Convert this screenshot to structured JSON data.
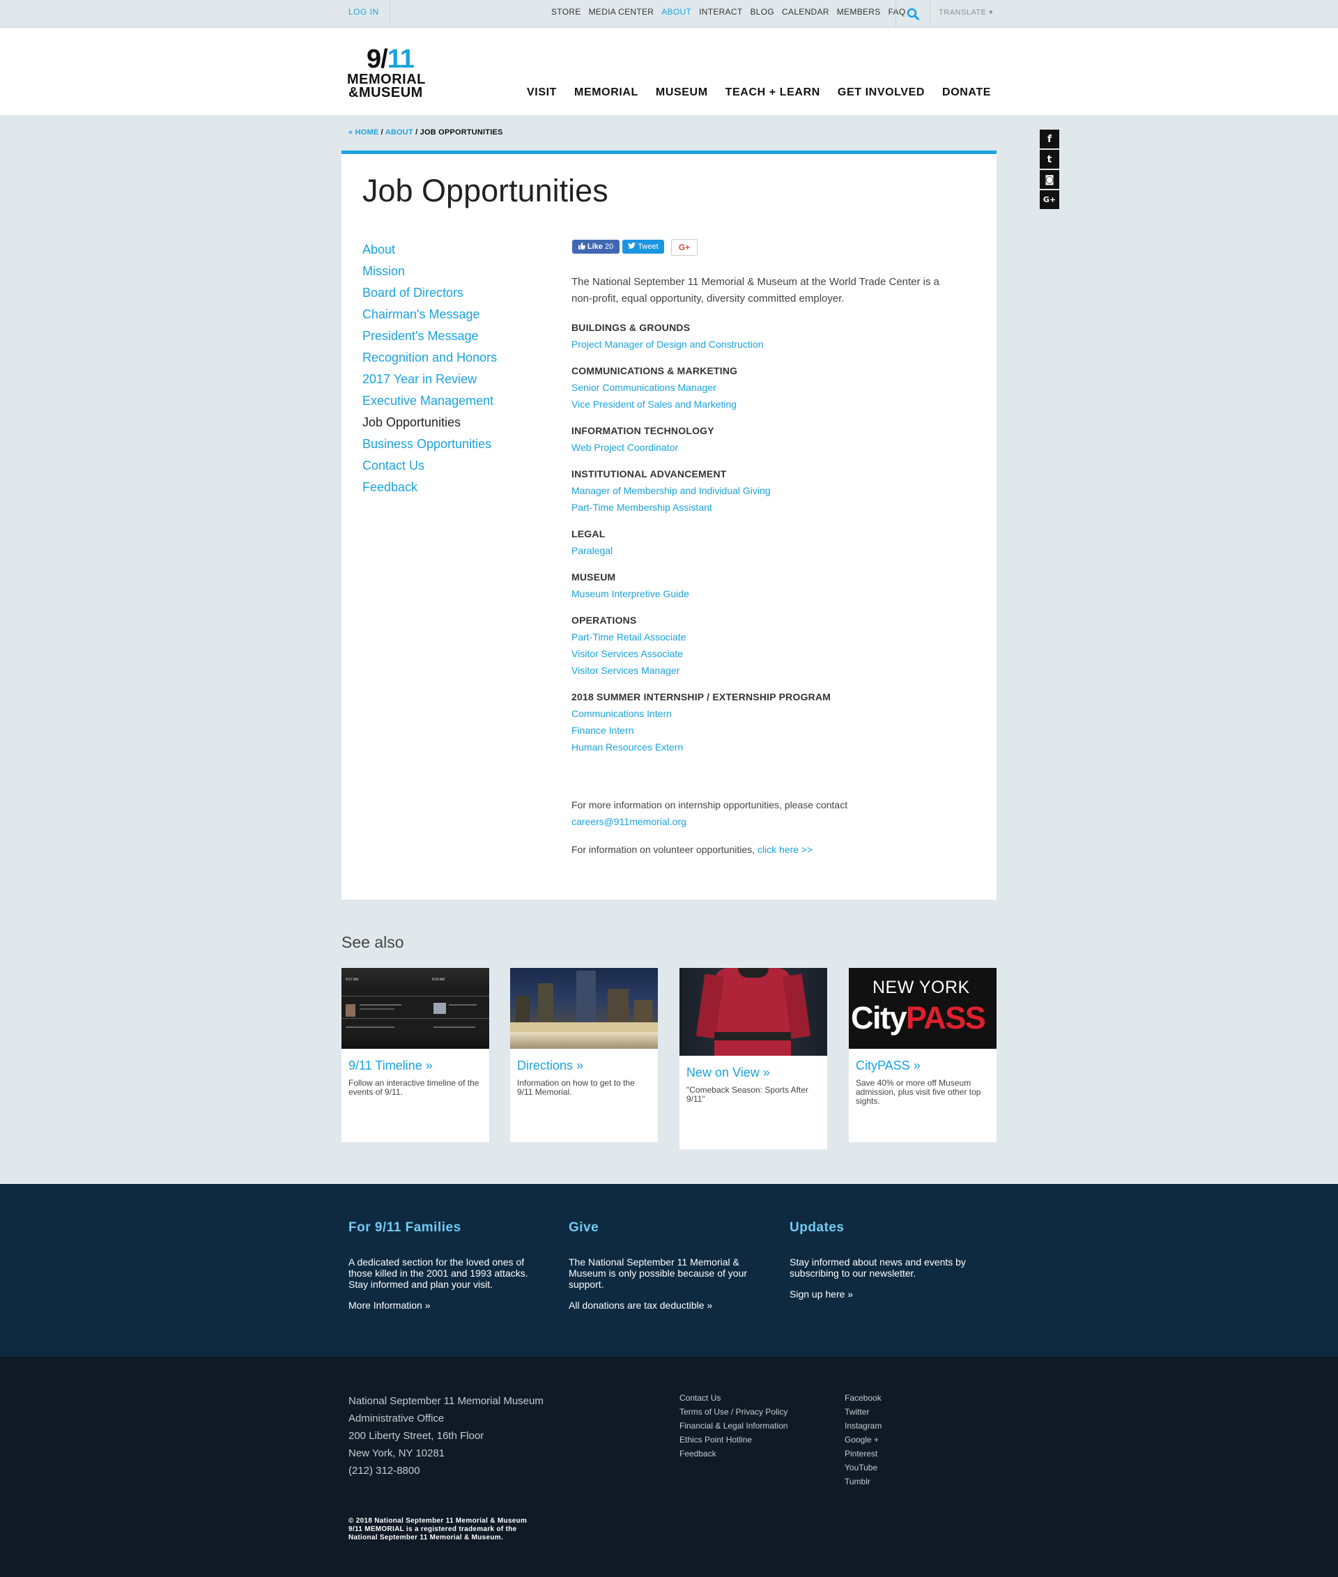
{
  "topbar": {
    "login": "LOG IN",
    "links": [
      {
        "label": "STORE",
        "active": false
      },
      {
        "label": "MEDIA CENTER",
        "active": false
      },
      {
        "label": "ABOUT",
        "active": true
      },
      {
        "label": "INTERACT",
        "active": false
      },
      {
        "label": "BLOG",
        "active": false
      },
      {
        "label": "CALENDAR",
        "active": false
      },
      {
        "label": "MEMBERS",
        "active": false
      },
      {
        "label": "FAQ",
        "active": false
      }
    ],
    "search_icon": "search-icon",
    "translate": "TRANSLATE ▾"
  },
  "logo": {
    "line1_a": "9/",
    "line1_b": "11",
    "line2": "MEMORIAL",
    "line3": "&MUSEUM"
  },
  "main_nav": [
    "VISIT",
    "MEMORIAL",
    "MUSEUM",
    "TEACH + LEARN",
    "GET INVOLVED",
    "DONATE"
  ],
  "breadcrumb": {
    "home": "« HOME",
    "sep1": " / ",
    "about": "ABOUT",
    "sep2": " / ",
    "current": "JOB OPPORTUNITIES"
  },
  "social_side": [
    {
      "icon": "facebook-icon",
      "glyph": "f"
    },
    {
      "icon": "twitter-icon",
      "glyph": "t"
    },
    {
      "icon": "instagram-icon",
      "glyph": "◙"
    },
    {
      "icon": "google-plus-icon",
      "glyph": "G+"
    }
  ],
  "page_title": "Job Opportunities",
  "side_nav": [
    {
      "label": "About",
      "current": false
    },
    {
      "label": "Mission",
      "current": false
    },
    {
      "label": "Board of Directors",
      "current": false
    },
    {
      "label": "Chairman's Message",
      "current": false
    },
    {
      "label": "President's Message",
      "current": false
    },
    {
      "label": "Recognition and Honors",
      "current": false
    },
    {
      "label": "2017 Year in Review",
      "current": false
    },
    {
      "label": "Executive Management",
      "current": false
    },
    {
      "label": "Job Opportunities",
      "current": true
    },
    {
      "label": "Business Opportunities",
      "current": false
    },
    {
      "label": "Contact Us",
      "current": false
    },
    {
      "label": "Feedback",
      "current": false
    }
  ],
  "share": {
    "like_label": "Like",
    "like_count": "20",
    "tweet_label": "Tweet",
    "gplus_label": "G+"
  },
  "intro": "The National September 11 Memorial & Museum at the World Trade Center is a non-profit, equal opportunity, diversity committed employer.",
  "departments": [
    {
      "title": "BUILDINGS & GROUNDS",
      "jobs": [
        "Project Manager of Design and Construction"
      ]
    },
    {
      "title": "COMMUNICATIONS & MARKETING",
      "jobs": [
        "Senior Communications Manager",
        "Vice President of Sales and Marketing"
      ]
    },
    {
      "title": "INFORMATION TECHNOLOGY",
      "jobs": [
        "Web Project Coordinator"
      ]
    },
    {
      "title": "INSTITUTIONAL ADVANCEMENT",
      "jobs": [
        "Manager of Membership and Individual Giving",
        "Part-Time Membership Assistant"
      ]
    },
    {
      "title": "LEGAL",
      "jobs": [
        "Paralegal"
      ]
    },
    {
      "title": "MUSEUM",
      "jobs": [
        "Museum Interpretive Guide"
      ]
    },
    {
      "title": "OPERATIONS",
      "jobs": [
        "Part-Time Retail Associate",
        "Visitor Services Associate",
        "Visitor Services Manager"
      ]
    },
    {
      "title": "2018 SUMMER INTERNSHIP / EXTERNSHIP PROGRAM",
      "jobs": [
        "Communications Intern",
        "Finance Intern",
        "Human Resources Extern"
      ]
    }
  ],
  "internship_info": {
    "text": "For more information on internship opportunities, please contact ",
    "email": "careers@911memorial.org"
  },
  "volunteer_info": {
    "text": "For information on volunteer opportunities, ",
    "link": "click here >>"
  },
  "see_also": {
    "title": "See also",
    "cards": [
      {
        "title": "9/11 Timeline »",
        "desc": "Follow an interactive timeline of the events of 9/11.",
        "time_a": "8:57 AM",
        "time_b": "8:59 AM"
      },
      {
        "title": "Directions »",
        "desc": "Information on how to get to the 9/11 Memorial."
      },
      {
        "title": "New on View »",
        "desc": "\"Comeback Season: Sports After 9/11\""
      },
      {
        "title": "CityPASS »",
        "desc": "Save 40% or more off Museum admission, plus visit five other top sights.",
        "logo_top": "NEW YORK",
        "logo_city": "City",
        "logo_pass": "PASS"
      }
    ]
  },
  "footer_cols": [
    {
      "title": "For 9/11 Families",
      "text": "A dedicated section for the loved ones of those killed in the 2001 and 1993 attacks. Stay informed and plan your visit.",
      "link": "More Information »"
    },
    {
      "title": "Give",
      "text": "The National September 11 Memorial & Museum is only possible because of your support.",
      "link": "All donations are tax deductible »"
    },
    {
      "title": "Updates",
      "text": "Stay informed about news and events by subscribing to our newsletter.",
      "link": "Sign up here »"
    }
  ],
  "address": [
    "National September 11 Memorial Museum",
    "Administrative Office",
    "200 Liberty Street, 16th Floor",
    "New York, NY 10281",
    "(212) 312-8800"
  ],
  "footer_links": [
    "Contact Us",
    "Terms of Use / Privacy Policy",
    "Financial & Legal Information",
    "Ethics Point Hotline",
    "Feedback"
  ],
  "social_links": [
    "Facebook",
    "Twitter",
    "Instagram",
    "Google +",
    "Pinterest",
    "YouTube",
    "Tumblr"
  ],
  "copyright": [
    "© 2018 National September 11 Memorial & Museum",
    "9/11 MEMORIAL is a registered trademark of the",
    "National September 11 Memorial & Museum."
  ],
  "colors": {
    "accent": "#1aa3de",
    "footer_top": "#0e2a40",
    "footer_bottom": "#0f1a26",
    "background": "#e1e8ec"
  }
}
